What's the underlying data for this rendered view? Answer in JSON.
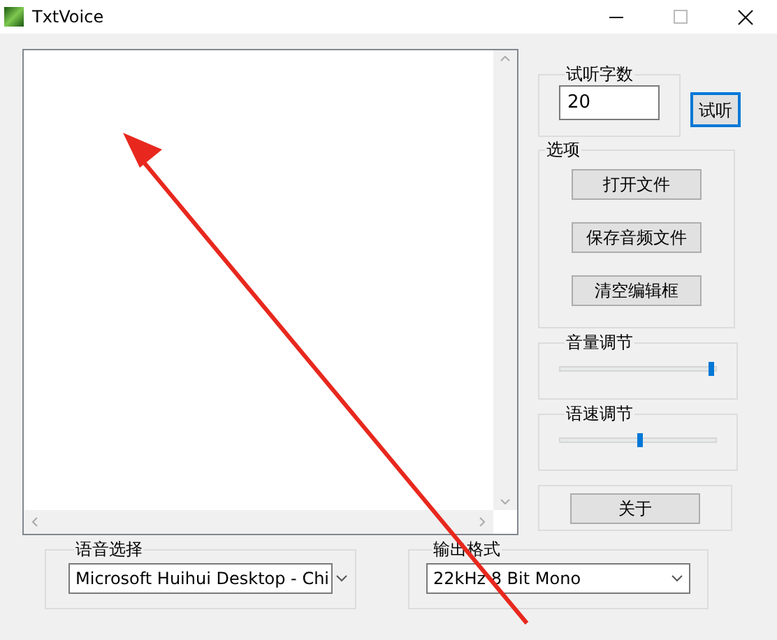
{
  "window": {
    "title": "TxtVoice"
  },
  "preview_group": {
    "title": "试听字数",
    "count": "20",
    "button": {
      "label": "试听",
      "focused": true
    }
  },
  "options_group": {
    "title": "选项",
    "buttons": [
      "打开文件",
      "保存音频文件",
      "清空编辑框"
    ]
  },
  "sliders": [
    {
      "title": "音量调节",
      "level": 0.97
    },
    {
      "title": "语速调节",
      "level": 0.5
    }
  ],
  "about_button": "关于",
  "voice_select": {
    "title": "语音选择",
    "value": "Microsoft Huihui Desktop - Chi"
  },
  "format_select": {
    "title": "输出格式",
    "value": "22kHz 8 Bit Mono"
  }
}
